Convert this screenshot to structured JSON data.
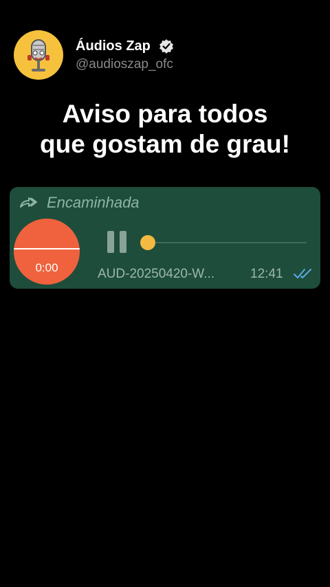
{
  "channel": {
    "name": "Áudios Zap",
    "handle": "@audioszap_ofc"
  },
  "headline": {
    "line1": "Aviso para todos",
    "line2": "que gostam de grau!"
  },
  "message": {
    "forwarded_label": "Encaminhada",
    "playback_time": "0:00",
    "file_name": "AUD-20250420-W...",
    "sent_time": "12:41",
    "progress": 0
  },
  "colors": {
    "background": "#000000",
    "bubble": "#1e4d3b",
    "play_circle": "#f0623d",
    "knob": "#f4b942",
    "read_ticks": "#5aa9e6"
  },
  "icons": {
    "verified": "verified-badge-icon",
    "forward": "forward-icon",
    "pause": "pause-icon",
    "read": "double-check-icon"
  }
}
